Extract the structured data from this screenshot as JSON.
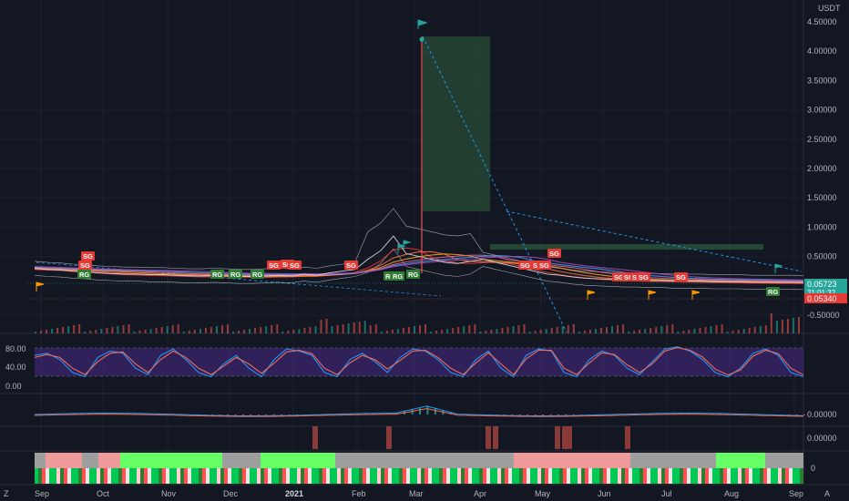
{
  "chart_data": {
    "type": "line",
    "currency": "USDT",
    "time_labels": [
      "Sep",
      "Oct",
      "Nov",
      "Dec",
      "2021",
      "Feb",
      "Mar",
      "Apr",
      "May",
      "Jun",
      "Jul",
      "Aug",
      "Sep"
    ],
    "price_axis": {
      "ticks": [
        "4.50000",
        "4.00000",
        "3.50000",
        "3.00000",
        "2.50000",
        "2.00000",
        "1.50000",
        "1.00000",
        "0.50000",
        "-0.50000"
      ],
      "range": [
        -0.8,
        4.8
      ],
      "last_price": "0.05723",
      "countdown": "21:01:32",
      "ref_price": "0.05340"
    },
    "price_series": [
      0.3,
      0.28,
      0.27,
      0.25,
      0.24,
      0.22,
      0.21,
      0.2,
      0.2,
      0.19,
      0.19,
      0.18,
      0.17,
      0.17,
      0.18,
      0.17,
      0.16,
      0.16,
      0.17,
      0.18,
      0.17,
      0.2,
      0.18,
      0.22,
      0.25,
      0.28,
      0.45,
      0.6,
      0.85,
      0.55,
      0.5,
      0.45,
      0.4,
      0.38,
      0.42,
      0.45,
      0.4,
      0.35,
      0.3,
      0.25,
      0.2,
      0.18,
      0.15,
      0.13,
      0.12,
      0.11,
      0.1,
      0.1,
      0.09,
      0.09,
      0.08,
      0.08,
      0.08,
      0.07,
      0.07,
      0.07,
      0.06,
      0.06,
      0.06,
      0.06,
      0.05723
    ],
    "spike_high": 4.2,
    "markers": {
      "SG": [
        "SG",
        "SG",
        "SG",
        "SG",
        "SG",
        "SG",
        "SG",
        "SG",
        "SG",
        "SG",
        "SG",
        "SG",
        "SG",
        "SG",
        "SG"
      ],
      "RG": [
        "RG",
        "RG",
        "RG",
        "RG",
        "RG",
        "RG",
        "RG",
        "RG"
      ]
    },
    "stoch": {
      "ticks": [
        "80.00",
        "40.00",
        "0.00"
      ],
      "k": [
        70,
        75,
        60,
        30,
        20,
        65,
        80,
        75,
        40,
        25,
        70,
        85,
        60,
        30,
        20,
        50,
        70,
        40,
        20,
        60,
        85,
        80,
        70,
        30,
        20,
        60,
        75,
        55,
        30,
        65,
        85,
        80,
        60,
        30,
        20,
        60,
        80,
        40,
        20,
        70,
        85,
        80,
        30,
        20,
        60,
        80,
        70,
        40,
        25,
        55,
        85,
        90,
        80,
        60,
        30,
        20,
        40,
        75,
        85,
        70,
        30,
        20
      ],
      "d": [
        65,
        72,
        65,
        40,
        25,
        55,
        75,
        78,
        50,
        30,
        60,
        80,
        65,
        40,
        25,
        45,
        65,
        50,
        28,
        52,
        78,
        82,
        74,
        40,
        25,
        52,
        70,
        60,
        38,
        58,
        80,
        82,
        65,
        40,
        25,
        52,
        76,
        50,
        25,
        62,
        82,
        82,
        40,
        25,
        52,
        76,
        72,
        48,
        30,
        50,
        80,
        88,
        82,
        66,
        38,
        24,
        36,
        68,
        82,
        74,
        40,
        24
      ],
      "band_high": 80,
      "band_low": 20
    },
    "macd": {
      "tick": "0.00000"
    },
    "oscillator": {
      "tick": "0.00000"
    },
    "trend_tick": "0",
    "colors": {
      "background": "#131722",
      "up": "#26a69a",
      "down": "#ef5350",
      "sg_badge": "#e53935",
      "rg_badge": "#2e7d32",
      "band_fill": "#4a2a8a",
      "k_line": "#2196f3",
      "d_line": "#ef6c57",
      "green_box": "#2e5e3e",
      "orange_flag": "#ff9800",
      "last_price_label": "#26a69a",
      "ref_price_label": "#e53935"
    }
  },
  "footer": {
    "left_icon": "Z",
    "right_icon": "A"
  }
}
